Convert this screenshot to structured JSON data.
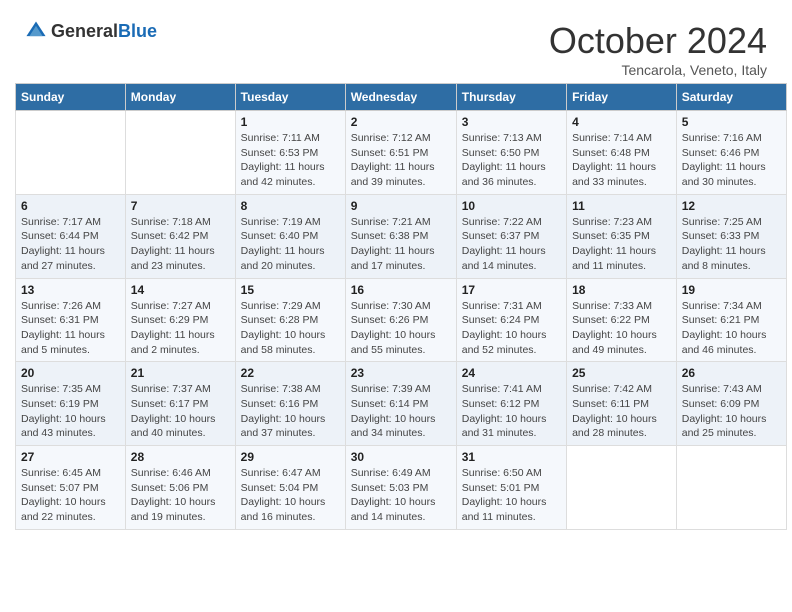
{
  "header": {
    "logo_general": "General",
    "logo_blue": "Blue",
    "month": "October 2024",
    "location": "Tencarola, Veneto, Italy"
  },
  "days_of_week": [
    "Sunday",
    "Monday",
    "Tuesday",
    "Wednesday",
    "Thursday",
    "Friday",
    "Saturday"
  ],
  "weeks": [
    [
      {
        "day": "",
        "info": ""
      },
      {
        "day": "",
        "info": ""
      },
      {
        "day": "1",
        "info": "Sunrise: 7:11 AM\nSunset: 6:53 PM\nDaylight: 11 hours and 42 minutes."
      },
      {
        "day": "2",
        "info": "Sunrise: 7:12 AM\nSunset: 6:51 PM\nDaylight: 11 hours and 39 minutes."
      },
      {
        "day": "3",
        "info": "Sunrise: 7:13 AM\nSunset: 6:50 PM\nDaylight: 11 hours and 36 minutes."
      },
      {
        "day": "4",
        "info": "Sunrise: 7:14 AM\nSunset: 6:48 PM\nDaylight: 11 hours and 33 minutes."
      },
      {
        "day": "5",
        "info": "Sunrise: 7:16 AM\nSunset: 6:46 PM\nDaylight: 11 hours and 30 minutes."
      }
    ],
    [
      {
        "day": "6",
        "info": "Sunrise: 7:17 AM\nSunset: 6:44 PM\nDaylight: 11 hours and 27 minutes."
      },
      {
        "day": "7",
        "info": "Sunrise: 7:18 AM\nSunset: 6:42 PM\nDaylight: 11 hours and 23 minutes."
      },
      {
        "day": "8",
        "info": "Sunrise: 7:19 AM\nSunset: 6:40 PM\nDaylight: 11 hours and 20 minutes."
      },
      {
        "day": "9",
        "info": "Sunrise: 7:21 AM\nSunset: 6:38 PM\nDaylight: 11 hours and 17 minutes."
      },
      {
        "day": "10",
        "info": "Sunrise: 7:22 AM\nSunset: 6:37 PM\nDaylight: 11 hours and 14 minutes."
      },
      {
        "day": "11",
        "info": "Sunrise: 7:23 AM\nSunset: 6:35 PM\nDaylight: 11 hours and 11 minutes."
      },
      {
        "day": "12",
        "info": "Sunrise: 7:25 AM\nSunset: 6:33 PM\nDaylight: 11 hours and 8 minutes."
      }
    ],
    [
      {
        "day": "13",
        "info": "Sunrise: 7:26 AM\nSunset: 6:31 PM\nDaylight: 11 hours and 5 minutes."
      },
      {
        "day": "14",
        "info": "Sunrise: 7:27 AM\nSunset: 6:29 PM\nDaylight: 11 hours and 2 minutes."
      },
      {
        "day": "15",
        "info": "Sunrise: 7:29 AM\nSunset: 6:28 PM\nDaylight: 10 hours and 58 minutes."
      },
      {
        "day": "16",
        "info": "Sunrise: 7:30 AM\nSunset: 6:26 PM\nDaylight: 10 hours and 55 minutes."
      },
      {
        "day": "17",
        "info": "Sunrise: 7:31 AM\nSunset: 6:24 PM\nDaylight: 10 hours and 52 minutes."
      },
      {
        "day": "18",
        "info": "Sunrise: 7:33 AM\nSunset: 6:22 PM\nDaylight: 10 hours and 49 minutes."
      },
      {
        "day": "19",
        "info": "Sunrise: 7:34 AM\nSunset: 6:21 PM\nDaylight: 10 hours and 46 minutes."
      }
    ],
    [
      {
        "day": "20",
        "info": "Sunrise: 7:35 AM\nSunset: 6:19 PM\nDaylight: 10 hours and 43 minutes."
      },
      {
        "day": "21",
        "info": "Sunrise: 7:37 AM\nSunset: 6:17 PM\nDaylight: 10 hours and 40 minutes."
      },
      {
        "day": "22",
        "info": "Sunrise: 7:38 AM\nSunset: 6:16 PM\nDaylight: 10 hours and 37 minutes."
      },
      {
        "day": "23",
        "info": "Sunrise: 7:39 AM\nSunset: 6:14 PM\nDaylight: 10 hours and 34 minutes."
      },
      {
        "day": "24",
        "info": "Sunrise: 7:41 AM\nSunset: 6:12 PM\nDaylight: 10 hours and 31 minutes."
      },
      {
        "day": "25",
        "info": "Sunrise: 7:42 AM\nSunset: 6:11 PM\nDaylight: 10 hours and 28 minutes."
      },
      {
        "day": "26",
        "info": "Sunrise: 7:43 AM\nSunset: 6:09 PM\nDaylight: 10 hours and 25 minutes."
      }
    ],
    [
      {
        "day": "27",
        "info": "Sunrise: 6:45 AM\nSunset: 5:07 PM\nDaylight: 10 hours and 22 minutes."
      },
      {
        "day": "28",
        "info": "Sunrise: 6:46 AM\nSunset: 5:06 PM\nDaylight: 10 hours and 19 minutes."
      },
      {
        "day": "29",
        "info": "Sunrise: 6:47 AM\nSunset: 5:04 PM\nDaylight: 10 hours and 16 minutes."
      },
      {
        "day": "30",
        "info": "Sunrise: 6:49 AM\nSunset: 5:03 PM\nDaylight: 10 hours and 14 minutes."
      },
      {
        "day": "31",
        "info": "Sunrise: 6:50 AM\nSunset: 5:01 PM\nDaylight: 10 hours and 11 minutes."
      },
      {
        "day": "",
        "info": ""
      },
      {
        "day": "",
        "info": ""
      }
    ]
  ]
}
